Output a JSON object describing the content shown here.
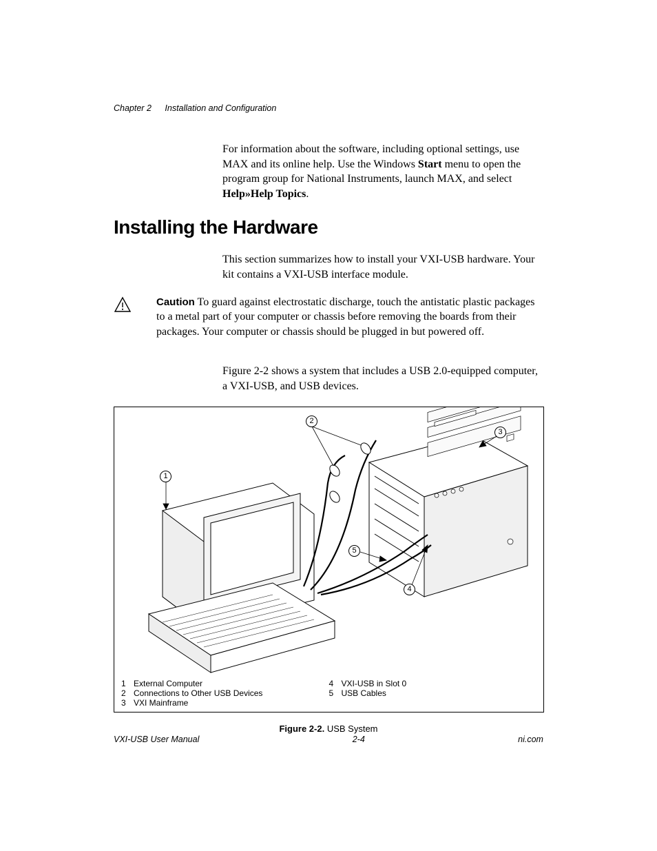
{
  "header": {
    "chapter_label": "Chapter 2",
    "chapter_title": "Installation and Configuration"
  },
  "intro": {
    "p1_a": "For information about the software, including optional settings, use MAX and its online help. Use the Windows ",
    "p1_b": "Start",
    "p1_c": " menu to open the program group for National Instruments, launch MAX, and select ",
    "p1_d": "Help»Help Topics",
    "p1_e": "."
  },
  "heading": "Installing the Hardware",
  "section": {
    "p1": "This section summarizes how to install your VXI-USB hardware. Your kit contains a VXI-USB interface module."
  },
  "caution": {
    "label": "Caution",
    "text": "   To guard against electrostatic discharge, touch the antistatic plastic packages to a metal part of your computer or chassis before removing the boards from their packages. Your computer or chassis should be plugged in but powered off."
  },
  "figure_ref": {
    "text": "Figure 2-2 shows a system that includes a USB 2.0-equipped computer, a VXI-USB, and USB devices."
  },
  "legend": {
    "col1": [
      {
        "n": "1",
        "label": "External Computer"
      },
      {
        "n": "2",
        "label": "Connections to Other USB Devices"
      },
      {
        "n": "3",
        "label": "VXI Mainframe"
      }
    ],
    "col2": [
      {
        "n": "4",
        "label": "VXI-USB in Slot 0"
      },
      {
        "n": "5",
        "label": "USB Cables"
      }
    ]
  },
  "callouts": {
    "c1": "1",
    "c2": "2",
    "c3": "3",
    "c4": "4",
    "c5": "5"
  },
  "figure_caption": {
    "label": "Figure 2-2.",
    "title": "  USB System"
  },
  "footer": {
    "left": "VXI-USB User Manual",
    "center": "2-4",
    "right": "ni.com"
  }
}
